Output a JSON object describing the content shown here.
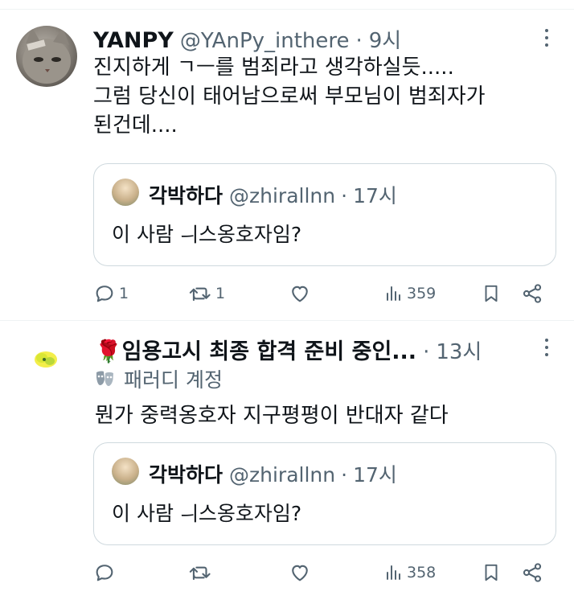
{
  "colors": {
    "text": "#0f1419",
    "secondary": "#536471",
    "border": "#cfd9de",
    "divider": "#eff3f4"
  },
  "posts": [
    {
      "author": "YANPY",
      "handle": "@YAnPy_inthere",
      "dot": "·",
      "time": "9시",
      "lines": [
        "진지하게 ㄱㅡ를 범죄라고 생각하실듯.....",
        "그럼 당신이 태어남으로써 부모님이 범죄자가",
        "된건데...."
      ],
      "quote": {
        "author": "각박하다",
        "handle": "@zhirallnn",
        "dot": "·",
        "time": "17시",
        "text": "이 사람 ㅢ스옹호자임?"
      },
      "actions": {
        "reply": "1",
        "repost": "1",
        "like": "",
        "views": "359"
      },
      "icons": {
        "reply": "reply-icon",
        "repost": "repost-icon",
        "like": "heart-icon",
        "views": "views-icon",
        "bookmark": "bookmark-icon",
        "share": "share-icon"
      }
    },
    {
      "author": "🌹임용고시 최종 합격 준비 중인...",
      "handle": "",
      "dot": "·",
      "time": "13시",
      "badge": "패러디 계정",
      "lines": [
        "뭔가 중력옹호자 지구평평이 반대자 같다"
      ],
      "quote": {
        "author": "각박하다",
        "handle": "@zhirallnn",
        "dot": "·",
        "time": "17시",
        "text": "이 사람 ㅢ스옹호자임?"
      },
      "actions": {
        "reply": "",
        "repost": "",
        "like": "",
        "views": "358"
      },
      "icons": {
        "reply": "reply-icon",
        "repost": "repost-icon",
        "like": "heart-icon",
        "views": "views-icon",
        "bookmark": "bookmark-icon",
        "share": "share-icon"
      }
    }
  ]
}
